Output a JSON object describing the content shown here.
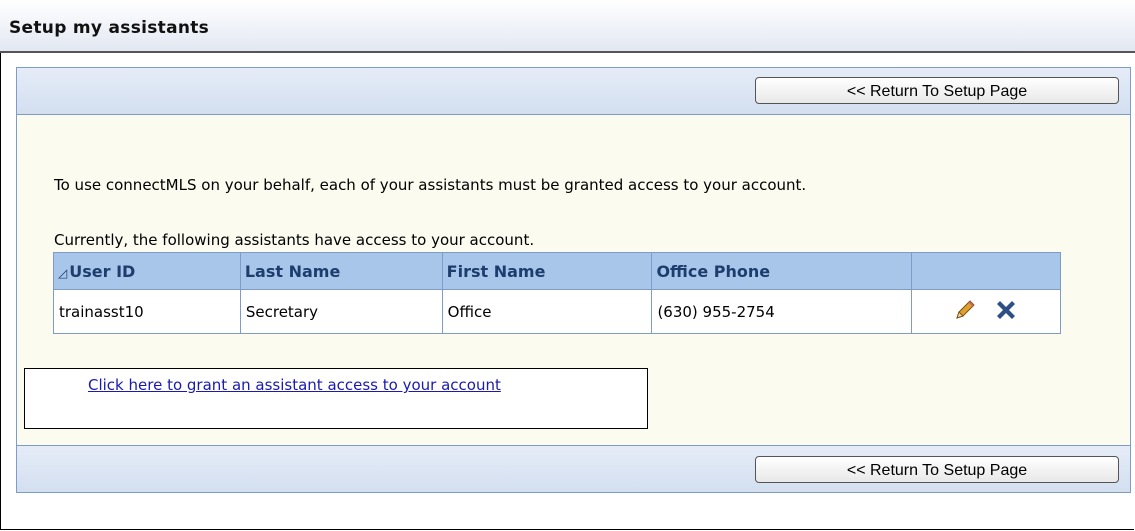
{
  "window": {
    "title": "Setup my assistants"
  },
  "toolbar": {
    "return_label": "<< Return To Setup Page"
  },
  "content": {
    "info_text": "To use connectMLS on your behalf, each of your assistants must be granted access to your account.",
    "current_text": "Currently, the following assistants have access to your account."
  },
  "table": {
    "headers": [
      "User ID",
      "Last Name",
      "First Name",
      "Office Phone",
      ""
    ],
    "sort_column": "User ID",
    "rows": [
      {
        "user_id": "trainasst10",
        "last_name": "Secretary",
        "first_name": "Office",
        "office_phone": "(630) 955-2754"
      }
    ]
  },
  "grant": {
    "link_label": "Click here to grant an assistant access to your account"
  },
  "colors": {
    "header_bg": "#a8c6ea",
    "header_text": "#1e3d6e",
    "panel_bg": "#fbfbf0",
    "delete_icon": "#2c4f86",
    "edit_icon": "#e0a030"
  },
  "icons": {
    "sort": "sort-ascending-icon",
    "edit": "pencil-icon",
    "delete": "close-x-icon"
  }
}
